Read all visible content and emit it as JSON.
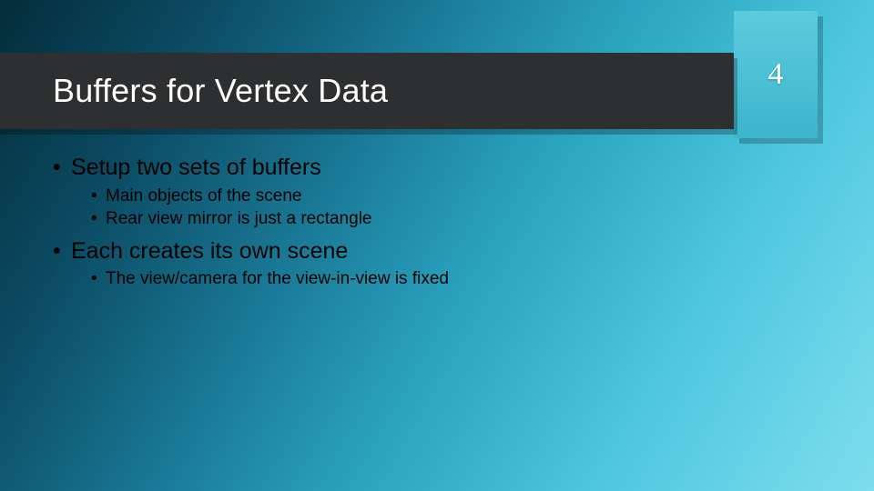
{
  "slide": {
    "title": "Buffers for Vertex Data",
    "page_number": "4",
    "bullets": [
      {
        "text": "Setup two sets of buffers",
        "children": [
          {
            "text": "Main objects of the scene"
          },
          {
            "text": "Rear view mirror is just a rectangle"
          }
        ]
      },
      {
        "text": "Each creates its own scene",
        "children": [
          {
            "text": "The view/camera for the view-in-view is fixed"
          }
        ]
      }
    ]
  }
}
